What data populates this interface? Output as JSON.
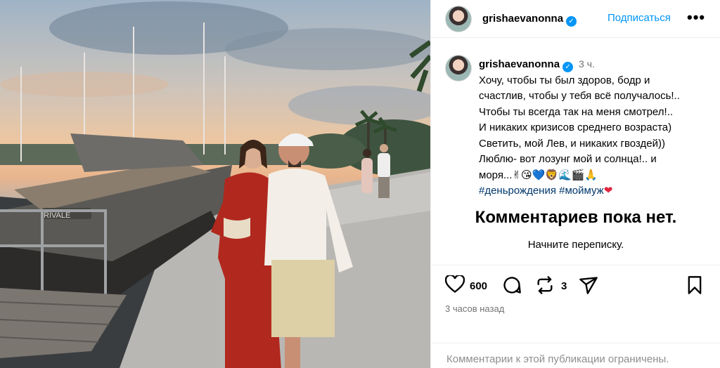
{
  "post": {
    "username": "grishaevanonna",
    "verified_mark": "✓",
    "follow_label": "Подписаться",
    "more_label": "•••",
    "caption_time": "3 ч.",
    "caption_lines": [
      "Хочу, чтобы ты был здоров, бодр и",
      "счастлив, чтобы у тебя всё получалось!..",
      "Чтобы ты всегда так на меня смотрел!..",
      "И никаких кризисов среднего возраста)",
      "Светить, мой Лев, и никаких гвоздей))",
      "Люблю- вот лозунг мой и солнца!.. и",
      "моря...✌😘💙🦁🌊🎬🙏"
    ],
    "hashtags": "#деньрождения #моймуж",
    "hashtag_heart": "❤",
    "no_comments_title": "Комментариев пока нет.",
    "start_conversation": "Начните переписку.",
    "likes_count": "600",
    "reposts_count": "3",
    "posted_time": "3 часов назад",
    "comments_limited": "Комментарии к этой публикации ограничены."
  },
  "photo": {
    "boat_name": "RIVALE"
  },
  "icons": {
    "like": "heart-icon",
    "comment": "comment-icon",
    "repost": "repost-icon",
    "share": "share-icon",
    "save": "bookmark-icon",
    "more": "more-icon"
  },
  "colors": {
    "accent": "#0095f6",
    "hashtag": "#00376b",
    "muted": "#737373",
    "heart": "#e0243e"
  }
}
